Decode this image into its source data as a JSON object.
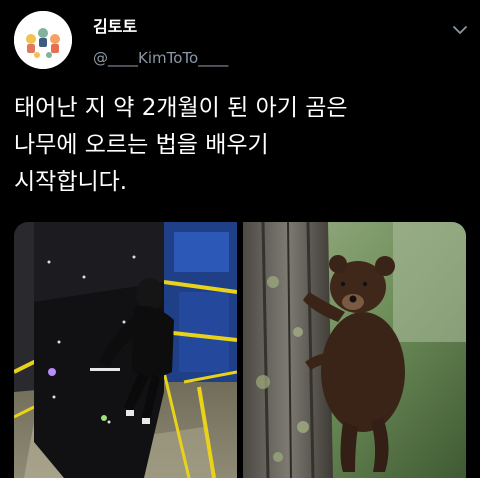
{
  "tweet": {
    "display_name": "김토토",
    "handle": "@____KimToTo____",
    "text": "태어난 지 약 2개월이 된 아기 곰은\n나무에 오르는 법을 배우기\n시작합니다."
  },
  "icons": {
    "menu": "chevron-down-icon"
  },
  "colors": {
    "background": "#000000",
    "text": "#ffffff",
    "secondary_text": "#8b98a5"
  }
}
